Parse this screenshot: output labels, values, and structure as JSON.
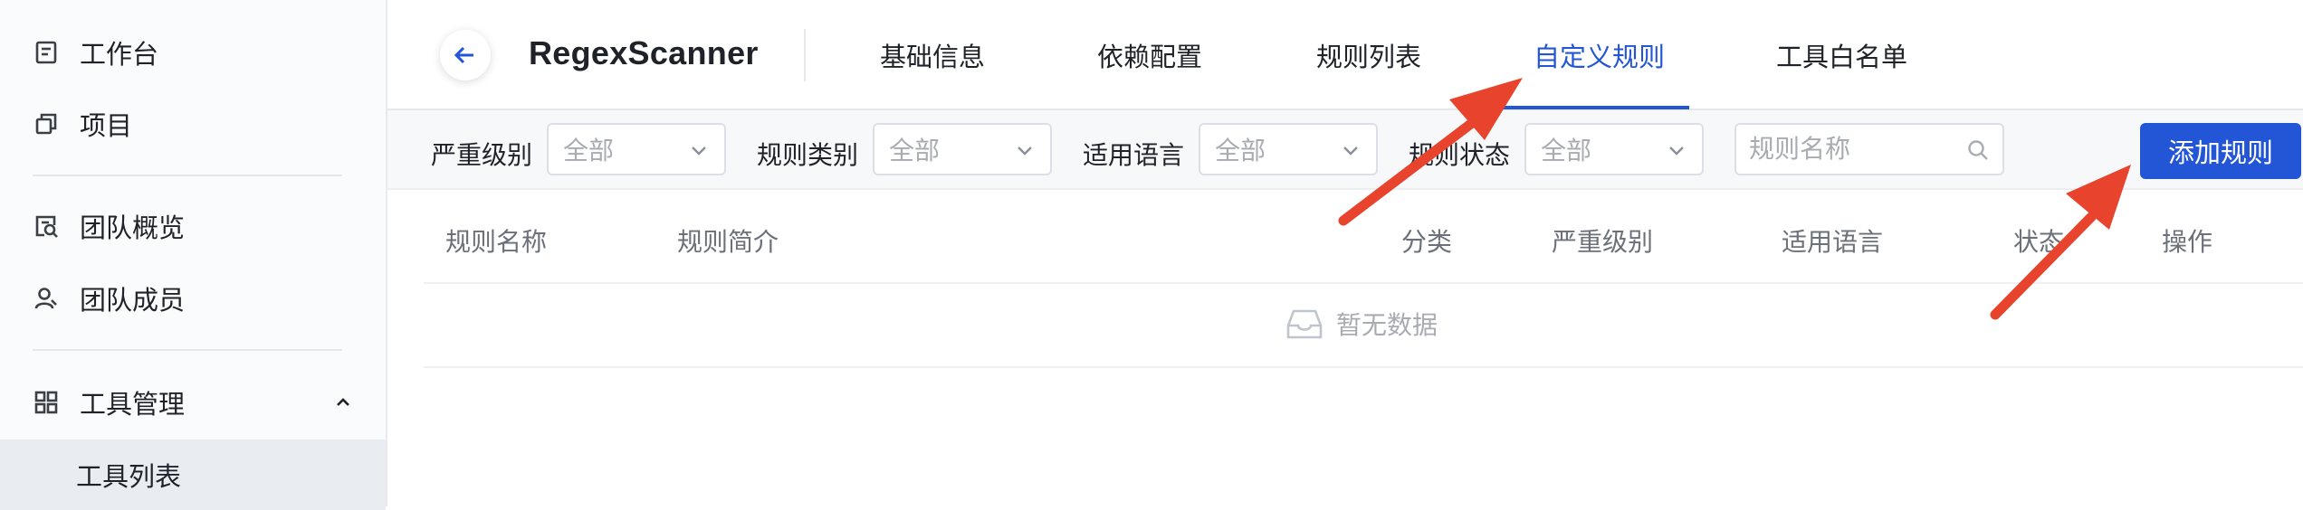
{
  "sidebar": {
    "items": [
      {
        "label": "工作台",
        "icon": "workbench-icon"
      },
      {
        "label": "项目",
        "icon": "project-icon"
      },
      {
        "label": "团队概览",
        "icon": "team-overview-icon"
      },
      {
        "label": "团队成员",
        "icon": "team-member-icon"
      },
      {
        "label": "工具管理",
        "icon": "grid-icon",
        "expanded": true
      },
      {
        "label": "工具列表",
        "selected": true
      }
    ]
  },
  "header": {
    "app_name": "RegexScanner",
    "tabs": [
      {
        "label": "基础信息"
      },
      {
        "label": "依赖配置"
      },
      {
        "label": "规则列表"
      },
      {
        "label": "自定义规则",
        "active": true
      },
      {
        "label": "工具白名单"
      }
    ]
  },
  "filters": {
    "severity_label": "严重级别",
    "severity_value": "全部",
    "category_label": "规则类别",
    "category_value": "全部",
    "language_label": "适用语言",
    "language_value": "全部",
    "status_label": "规则状态",
    "status_value": "全部",
    "search_placeholder": "规则名称",
    "add_button": "添加规则"
  },
  "table": {
    "columns": [
      "规则名称",
      "规则简介",
      "分类",
      "严重级别",
      "适用语言",
      "状态",
      "操作"
    ],
    "rows": [],
    "empty_text": "暂无数据"
  },
  "colors": {
    "accent": "#2356d6",
    "annotation_arrow": "#e8432d"
  }
}
